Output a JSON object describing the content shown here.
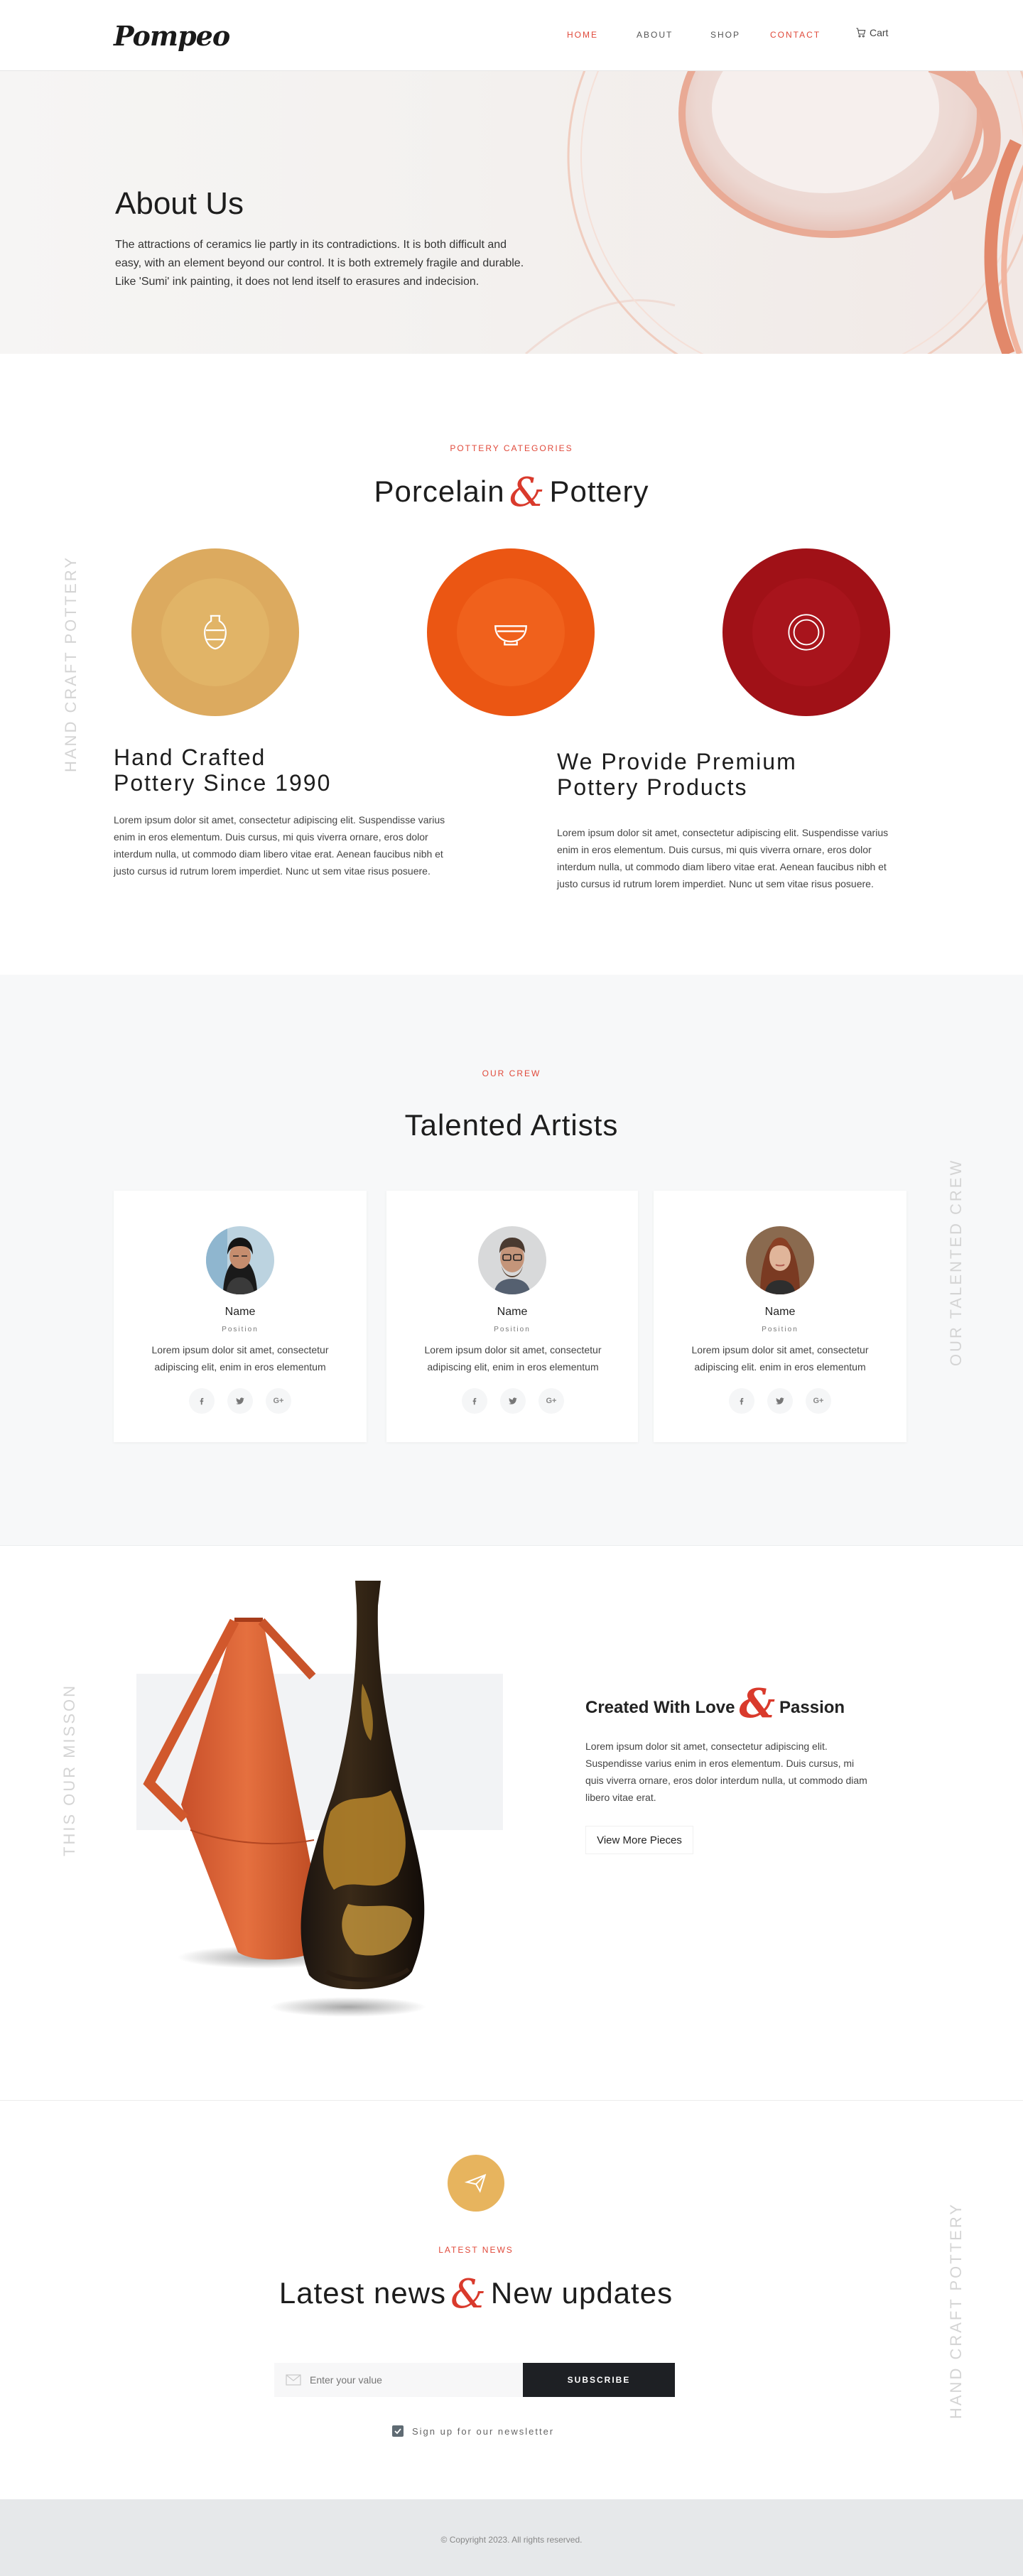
{
  "header": {
    "logo": "Pompeo",
    "nav": [
      {
        "label": "Home"
      },
      {
        "label": "About"
      },
      {
        "label": "Shop"
      },
      {
        "label": "Contact"
      }
    ],
    "cart_label": "Cart",
    "active_color": "#e0493a"
  },
  "hero": {
    "title": "About Us",
    "text": "The attractions of ceramics lie partly in its contradictions. It is both difficult and easy, with an element beyond our control. It is both extremely fragile and durable. Like 'Sumi' ink painting, it does not lend itself to erasures and indecision."
  },
  "categories": {
    "eyebrow": "Pottery Categories",
    "title_left": "Porcelain",
    "amp": "&",
    "title_right": "Pottery",
    "side_label": "Hand Craft Pottery",
    "circles": [
      {
        "icon": "vase-icon",
        "color": "#dcaa5f"
      },
      {
        "icon": "bowl-icon",
        "color": "#f05a14"
      },
      {
        "icon": "plate-icon",
        "color": "#a8121a"
      }
    ],
    "blocks": [
      {
        "title_line1": "Hand Crafted",
        "title_line2": "Pottery Since 1990",
        "text": "Lorem ipsum dolor sit amet, consectetur adipiscing elit. Suspendisse varius enim in eros elementum. Duis cursus, mi quis viverra ornare, eros dolor interdum nulla, ut commodo diam libero vitae erat. Aenean faucibus nibh et justo cursus id rutrum lorem imperdiet. Nunc ut sem vitae risus posuere."
      },
      {
        "title_line1": "We Provide Premium",
        "title_line2": "Pottery Products",
        "text": "Lorem ipsum dolor sit amet, consectetur adipiscing elit. Suspendisse varius enim in eros elementum. Duis cursus, mi quis viverra ornare, eros dolor interdum nulla, ut commodo diam libero vitae erat. Aenean faucibus nibh et justo cursus id rutrum lorem imperdiet. Nunc ut sem vitae risus posuere."
      }
    ]
  },
  "team": {
    "eyebrow": "Our Crew",
    "title": "Talented Artists",
    "side_label": "Our Talented Crew",
    "members": [
      {
        "name": "Name",
        "position": "Position",
        "text": "Lorem ipsum dolor sit amet, consectetur adipiscing elit, enim in eros elementum"
      },
      {
        "name": "Name",
        "position": "Position",
        "text": "Lorem ipsum dolor sit amet, consectetur adipiscing elit, enim in eros elementum"
      },
      {
        "name": "Name",
        "position": "Position",
        "text": "Lorem ipsum dolor sit amet, consectetur adipiscing elit. enim in eros elementum"
      }
    ],
    "social_icons": [
      "facebook-icon",
      "twitter-icon",
      "google-plus-icon"
    ]
  },
  "mission": {
    "side_label": "This Our Misson",
    "title_left": "Created With Love",
    "amp": "&",
    "title_right": "Passion",
    "text": "Lorem ipsum dolor sit amet, consectetur adipiscing elit. Suspendisse varius enim in eros elementum. Duis cursus, mi quis viverra ornare, eros dolor interdum nulla, ut commodo diam libero vitae erat.",
    "button": "View More Pieces"
  },
  "news": {
    "eyebrow": "Latest News",
    "title_left": "Latest news",
    "amp": "&",
    "title_right": "New updates",
    "side_label": "Hand Craft Pottery",
    "input_placeholder": "Enter your value",
    "button": "Subscribe",
    "checkbox_label": "Sign up for our newsletter",
    "checkbox_checked": true
  },
  "footer": {
    "copyright": "© Copyright 2023. All rights reserved."
  }
}
